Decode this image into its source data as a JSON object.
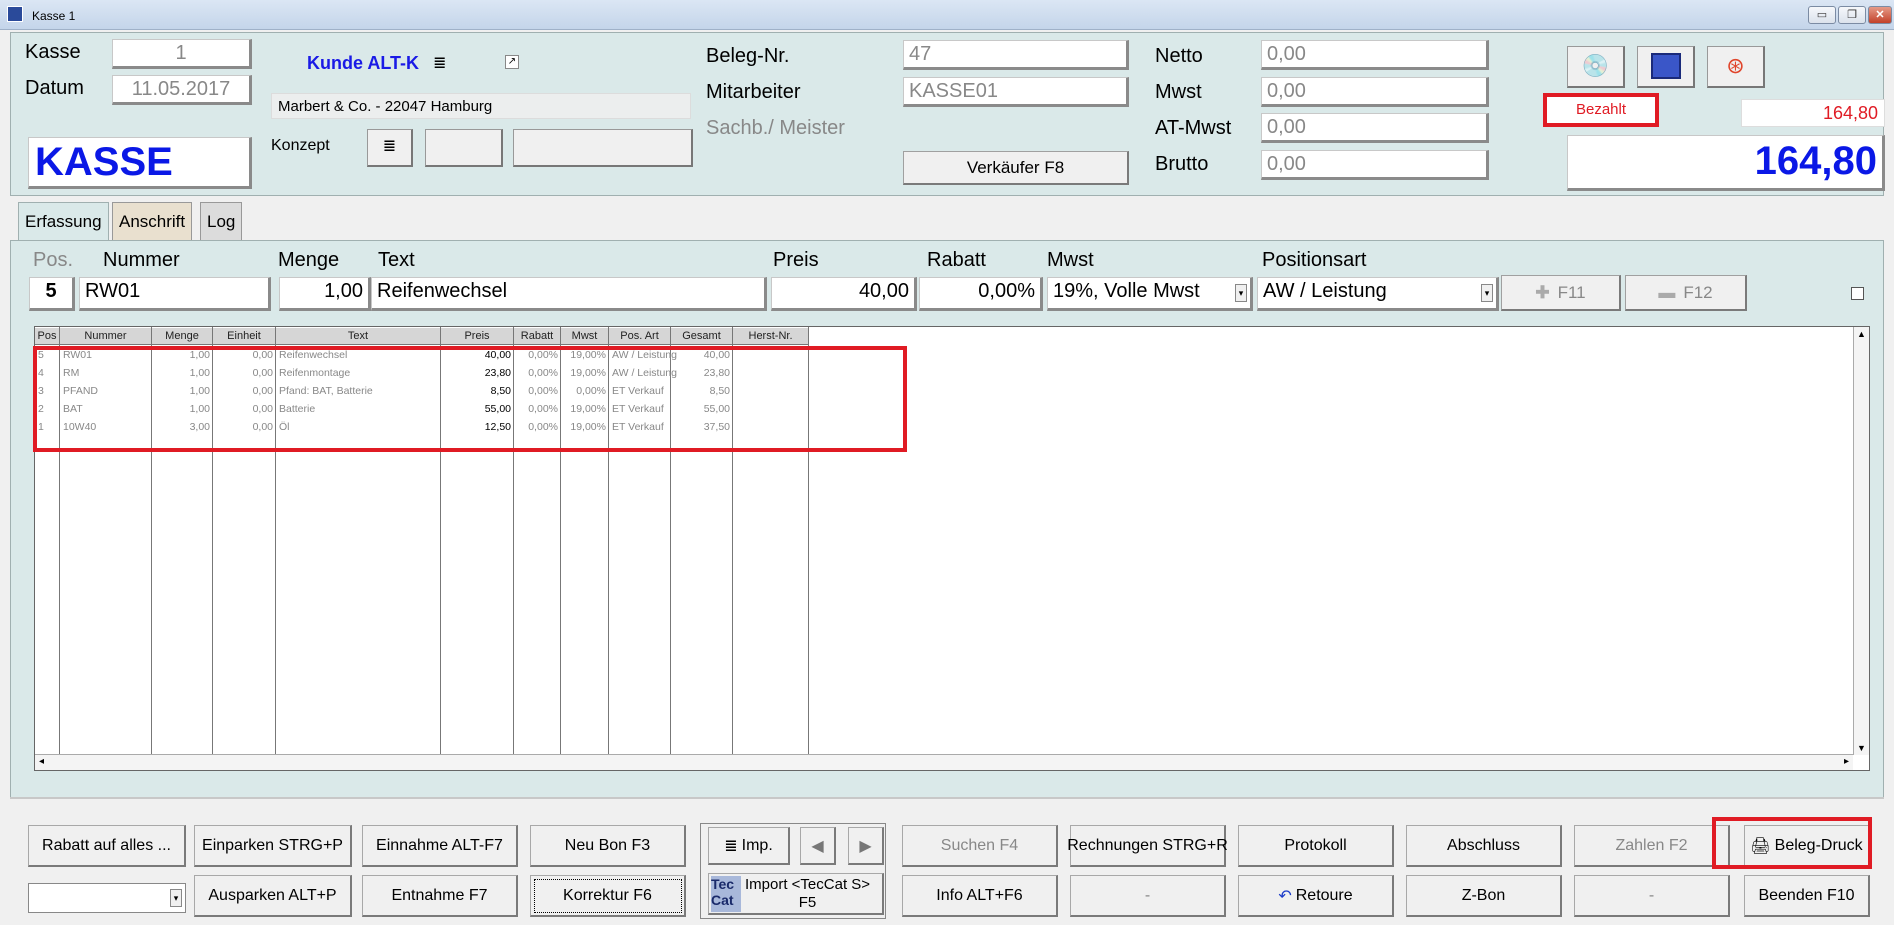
{
  "window": {
    "title": "Kasse 1"
  },
  "header": {
    "kasse_label": "Kasse",
    "kasse_value": "1",
    "datum_label": "Datum",
    "datum_value": "11.05.2017",
    "mode_label": "KASSE",
    "kunde_label": "Kunde ALT-K",
    "customer": "Marbert & Co. - 22047 Hamburg",
    "konzept_label": "Konzept",
    "beleg_label": "Beleg-Nr.",
    "beleg_value": "47",
    "mitarbeiter_label": "Mitarbeiter",
    "mitarbeiter_value": "KASSE01",
    "sachb_label": "Sachb./ Meister",
    "verkaeufer_button": "Verkäufer F8",
    "netto_label": "Netto",
    "netto_value": "0,00",
    "mwst_label": "Mwst",
    "mwst_value": "0,00",
    "atmwst_label": "AT-Mwst",
    "atmwst_value": "0,00",
    "brutto_label": "Brutto",
    "brutto_value": "0,00",
    "status": "Bezahlt",
    "paid_amount": "164,80",
    "total": "164,80"
  },
  "tabs": [
    {
      "label": "Erfassung"
    },
    {
      "label": "Anschrift"
    },
    {
      "label": "Log"
    }
  ],
  "entry": {
    "pos_label": "Pos.",
    "pos_value": "5",
    "nummer_label": "Nummer",
    "nummer_value": "RW01",
    "menge_label": "Menge",
    "menge_value": "1,00",
    "text_label": "Text",
    "text_value": "Reifenwechsel",
    "preis_label": "Preis",
    "preis_value": "40,00",
    "rabatt_label": "Rabatt",
    "rabatt_value": "0,00%",
    "mwst_label": "Mwst",
    "mwst_value": "19%, Volle Mwst",
    "positionsart_label": "Positionsart",
    "positionsart_value": "AW / Leistung",
    "f11_label": "F11",
    "f12_label": "F12"
  },
  "grid": {
    "columns": [
      "Pos",
      "Nummer",
      "Menge",
      "Einheit",
      "Text",
      "Preis",
      "Rabatt",
      "Mwst",
      "Pos. Art",
      "Gesamt",
      "Herst-Nr."
    ],
    "rows": [
      [
        "5",
        "RW01",
        "1,00",
        "0,00",
        "Reifenwechsel",
        "40,00",
        "0,00%",
        "19,00%",
        "AW / Leistung",
        "40,00",
        ""
      ],
      [
        "4",
        "RM",
        "1,00",
        "0,00",
        "Reifenmontage",
        "23,80",
        "0,00%",
        "19,00%",
        "AW / Leistung",
        "23,80",
        ""
      ],
      [
        "3",
        "PFAND",
        "1,00",
        "0,00",
        "Pfand: BAT, Batterie",
        "8,50",
        "0,00%",
        "0,00%",
        "ET Verkauf",
        "8,50",
        ""
      ],
      [
        "2",
        "BAT",
        "1,00",
        "0,00",
        "Batterie",
        "55,00",
        "0,00%",
        "19,00%",
        "ET Verkauf",
        "55,00",
        ""
      ],
      [
        "1",
        "10W40",
        "3,00",
        "0,00",
        "Öl",
        "12,50",
        "0,00%",
        "19,00%",
        "ET Verkauf",
        "37,50",
        ""
      ]
    ]
  },
  "buttons": {
    "rabatt_alles": "Rabatt auf alles ...",
    "einparken": "Einparken STRG+P",
    "einnahme": "Einnahme ALT-F7",
    "neu_bon": "Neu Bon F3",
    "imp": "Imp.",
    "suchen": "Suchen F4",
    "rechnungen": "Rechnungen STRG+R",
    "protokoll": "Protokoll",
    "abschluss": "Abschluss",
    "zahlen": "Zahlen F2",
    "beleg_druck": "Beleg-Druck",
    "auskparken": "Ausparken ALT+P",
    "entnahme": "Entnahme F7",
    "korrektur": "Korrektur F6",
    "import_tec": "Import <TecCat S>",
    "import_key": "F5",
    "tec_logo": "Tec Cat",
    "info": "Info ALT+F6",
    "dash1": "-",
    "retoure": "Retoure",
    "zbon": "Z-Bon",
    "dash2": "-",
    "beenden": "Beenden F10"
  },
  "colors": {
    "accent_blue": "#0000ee",
    "status_red": "#e01b24",
    "panel": "#dae9e9"
  }
}
